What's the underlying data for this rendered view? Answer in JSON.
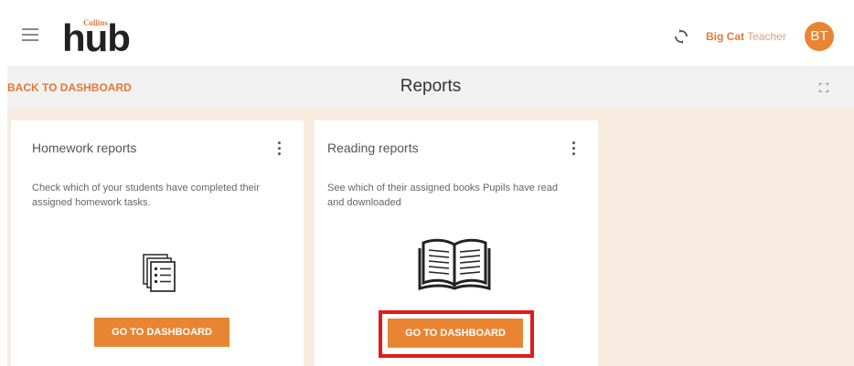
{
  "header": {
    "logo_top": "Collins",
    "logo_main": "hub",
    "user_first": "Big Cat",
    "user_role": " Teacher",
    "avatar_initials": "BT"
  },
  "subheader": {
    "back_label": "BACK TO DASHBOARD",
    "title": "Reports"
  },
  "cards": [
    {
      "title": "Homework reports",
      "description": "Check which of your students have completed their assigned homework tasks.",
      "icon": "document-list-icon",
      "button": "GO TO DASHBOARD"
    },
    {
      "title": "Reading reports",
      "description": "See which of their assigned books Pupils have read and downloaded",
      "icon": "open-book-icon",
      "button": "GO TO DASHBOARD"
    }
  ],
  "colors": {
    "accent": "#e98532",
    "content_bg": "#f8ece0",
    "highlight": "#e01b1b"
  }
}
